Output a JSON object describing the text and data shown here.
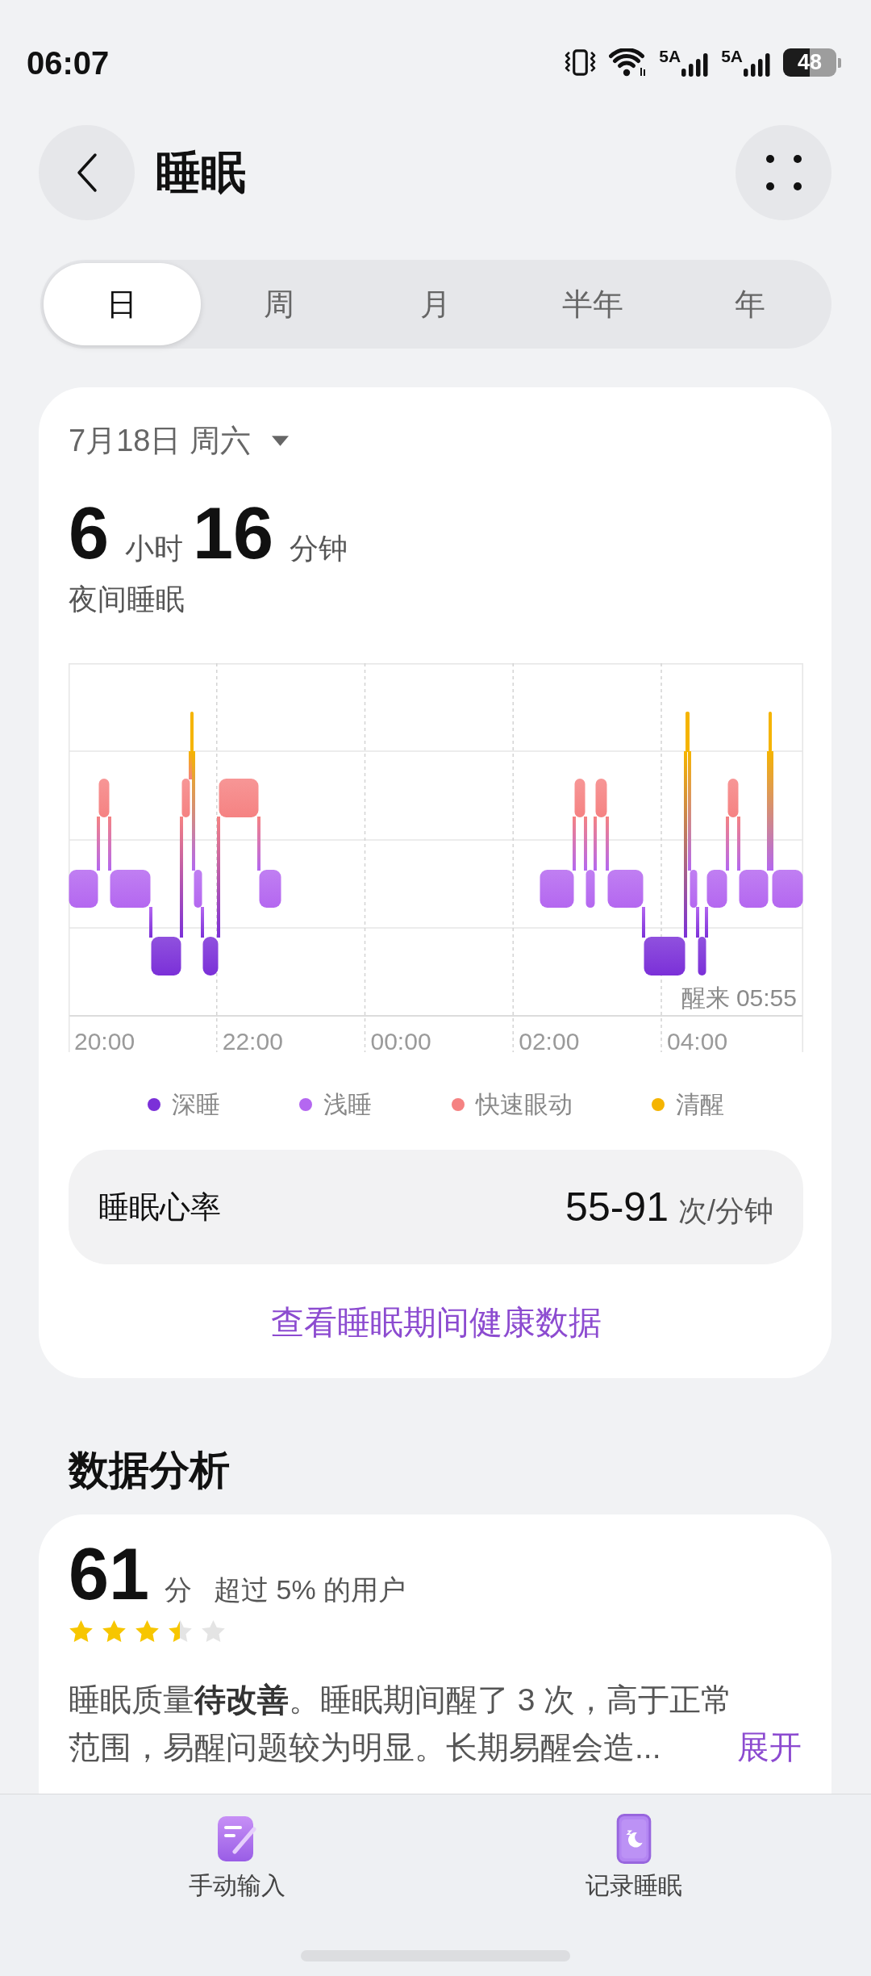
{
  "status_bar": {
    "time": "06:07",
    "networks": [
      "5A",
      "5A"
    ],
    "battery": "48"
  },
  "header": {
    "title": "睡眠"
  },
  "tabs": [
    {
      "label": "日",
      "selected": true
    },
    {
      "label": "周",
      "selected": false
    },
    {
      "label": "月",
      "selected": false
    },
    {
      "label": "半年",
      "selected": false
    },
    {
      "label": "年",
      "selected": false
    }
  ],
  "sleep_card": {
    "date": "7月18日 周六",
    "hours": "6",
    "hours_unit": "小时",
    "minutes": "16",
    "minutes_unit": "分钟",
    "caption": "夜间睡眠",
    "chart": {
      "x_labels": [
        "20:00",
        "22:00",
        "00:00",
        "02:00",
        "04:00"
      ],
      "wake_label": "醒来 05:55"
    },
    "legend": [
      {
        "label": "深睡",
        "color": "#7b30d8"
      },
      {
        "label": "浅睡",
        "color": "#b467f0"
      },
      {
        "label": "快速眼动",
        "color": "#f58282"
      },
      {
        "label": "清醒",
        "color": "#f5b400"
      }
    ],
    "heart_rate": {
      "label": "睡眠心率",
      "value": "55-91",
      "unit": "次/分钟"
    },
    "link": "查看睡眠期间健康数据"
  },
  "analysis": {
    "title": "数据分析",
    "score": "61",
    "score_unit": "分",
    "comparison": "超过 5% 的用户",
    "stars": 3.5,
    "summary": "睡眠质量**待改善**。睡眠期间醒了 3 次，高于正常范围，易醒问题较为明显。长期易醒会造...",
    "expand": "展开"
  },
  "bottom_actions": [
    {
      "kind": "manual",
      "label": "手动输入"
    },
    {
      "kind": "record",
      "label": "记录睡眠"
    }
  ]
}
